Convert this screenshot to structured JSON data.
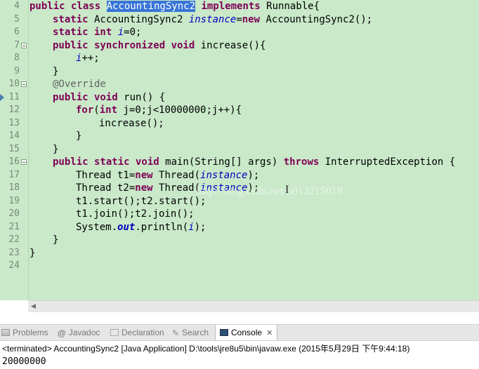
{
  "editor": {
    "line_numbers": [
      "4",
      "5",
      "6",
      "7",
      "8",
      "9",
      "10",
      "11",
      "12",
      "13",
      "14",
      "15",
      "16",
      "17",
      "18",
      "19",
      "20",
      "21",
      "22",
      "23",
      "24"
    ]
  },
  "code": {
    "l4_a": "public class ",
    "l4_sel": "AccountingSync2",
    "l4_b": " ",
    "l4_kw": "implements",
    "l4_c": " Runnable{",
    "l5_kw": "static",
    "l5_a": " AccountingSync2 ",
    "l5_fld": "instance",
    "l5_b": "=",
    "l5_kw2": "new",
    "l5_c": " AccountingSync2();",
    "l6_kw": "static int",
    "l6_a": " ",
    "l6_fld": "i",
    "l6_b": "=0;",
    "l7_kw": "public synchronized void",
    "l7_a": " increase(){",
    "l8_fld": "i",
    "l8_a": "++;",
    "l9": "}",
    "l10_ann": "@Override",
    "l11_kw": "public void",
    "l11_a": " run() {",
    "l12_kw": "for",
    "l12_a": "(",
    "l12_kw2": "int",
    "l12_b": " j=0;j<10000000;j++){",
    "l13": "increase();",
    "l14": "}",
    "l15": "}",
    "l16_kw": "public static void",
    "l16_a": " main(String[] args) ",
    "l16_kw2": "throws",
    "l16_b": " InterruptedException {",
    "l17_a": "Thread t1=",
    "l17_kw": "new",
    "l17_b": " Thread(",
    "l17_fld": "instance",
    "l17_c": ");",
    "l18_a": "Thread t2=",
    "l18_kw": "new",
    "l18_b": " Thread(",
    "l18_fld": "instance",
    "l18_c": ");",
    "l19": "t1.start();t2.start();",
    "l20": "t1.join();t2.join();",
    "l21_a": "System.",
    "l21_fld": "out",
    "l21_b": ".println(",
    "l21_fld2": "i",
    "l21_c": ");",
    "l22": "}",
    "l23": "}"
  },
  "watermark": "http://blog.csdn.net/u013215018",
  "console_tabs": {
    "problems": "Problems",
    "javadoc": "Javadoc",
    "javadoc_icon": "@",
    "declaration": "Declaration",
    "search": "Search",
    "console": "Console",
    "close": "✕"
  },
  "console": {
    "status": "<terminated> AccountingSync2 [Java Application] D:\\tools\\jre8u5\\bin\\javaw.exe (2015年5月29日 下午9:44:18)",
    "output": "20000000"
  },
  "colors": {
    "editor_bg": "#c9e9c9",
    "keyword": "#7f0055",
    "field": "#0000c0",
    "annotation": "#646464",
    "selection": "#3875d7"
  }
}
